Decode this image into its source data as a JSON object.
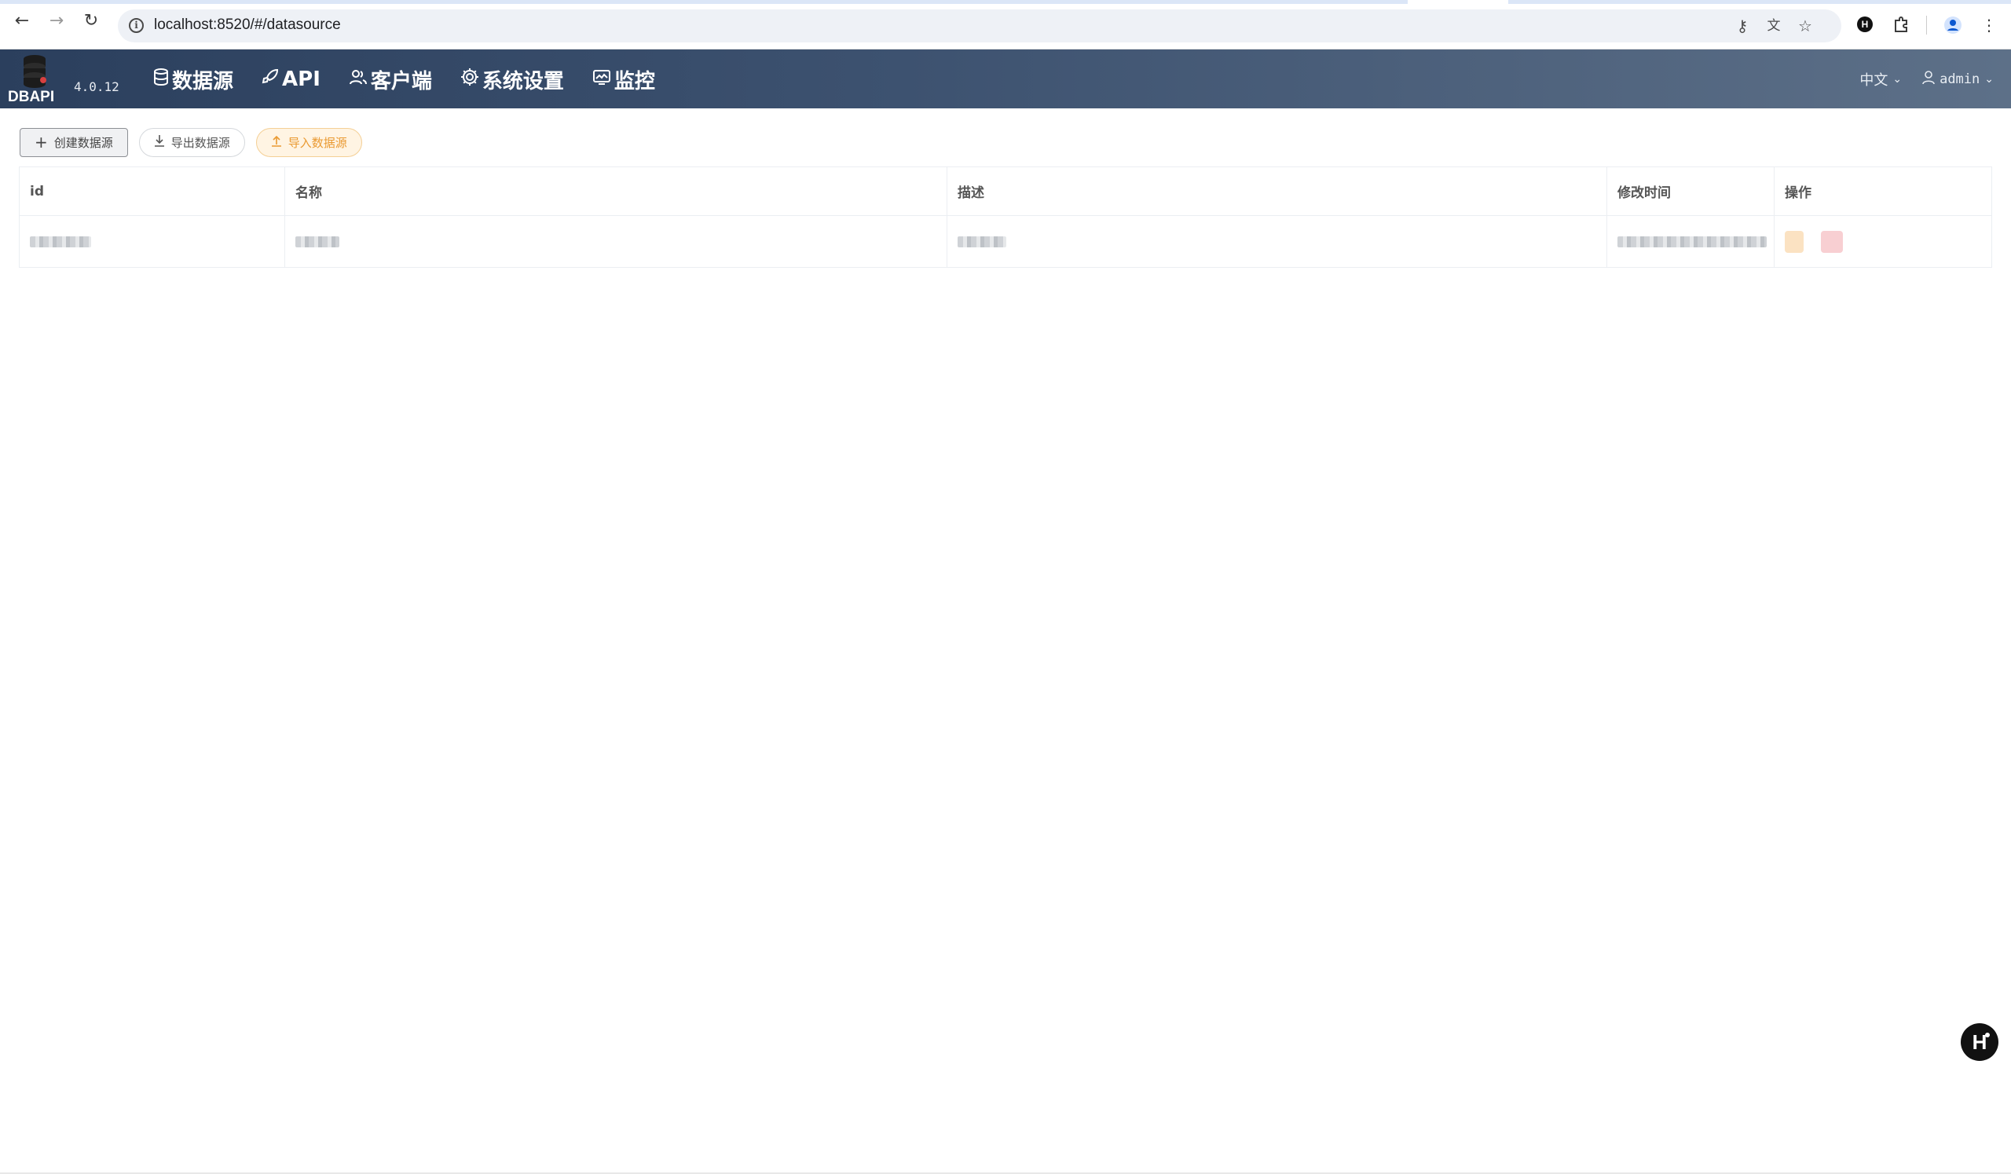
{
  "browser": {
    "url": "localhost:8520/#/datasource",
    "back_icon": "arrow-left-icon",
    "forward_icon": "arrow-right-icon",
    "reload_icon": "reload-icon",
    "site_info_icon": "info-icon"
  },
  "app": {
    "logo_text": "DBAPI",
    "version": "4.0.12",
    "brand_colors": {
      "header_start": "#2b3f5d",
      "header_end": "#5d7088",
      "import_accent": "#ea9a32"
    },
    "menu": [
      {
        "label": "数据源",
        "icon": "database-icon"
      },
      {
        "label": "API",
        "icon": "rocket-icon"
      },
      {
        "label": "客户端",
        "icon": "users-icon"
      },
      {
        "label": "系统设置",
        "icon": "gear-icon"
      },
      {
        "label": "监控",
        "icon": "monitor-icon"
      }
    ],
    "language": "中文",
    "user": "admin"
  },
  "toolbar": {
    "create_label": "创建数据源",
    "export_label": "导出数据源",
    "import_label": "导入数据源"
  },
  "table": {
    "columns": [
      "id",
      "名称",
      "描述",
      "修改时间",
      "操作"
    ]
  }
}
